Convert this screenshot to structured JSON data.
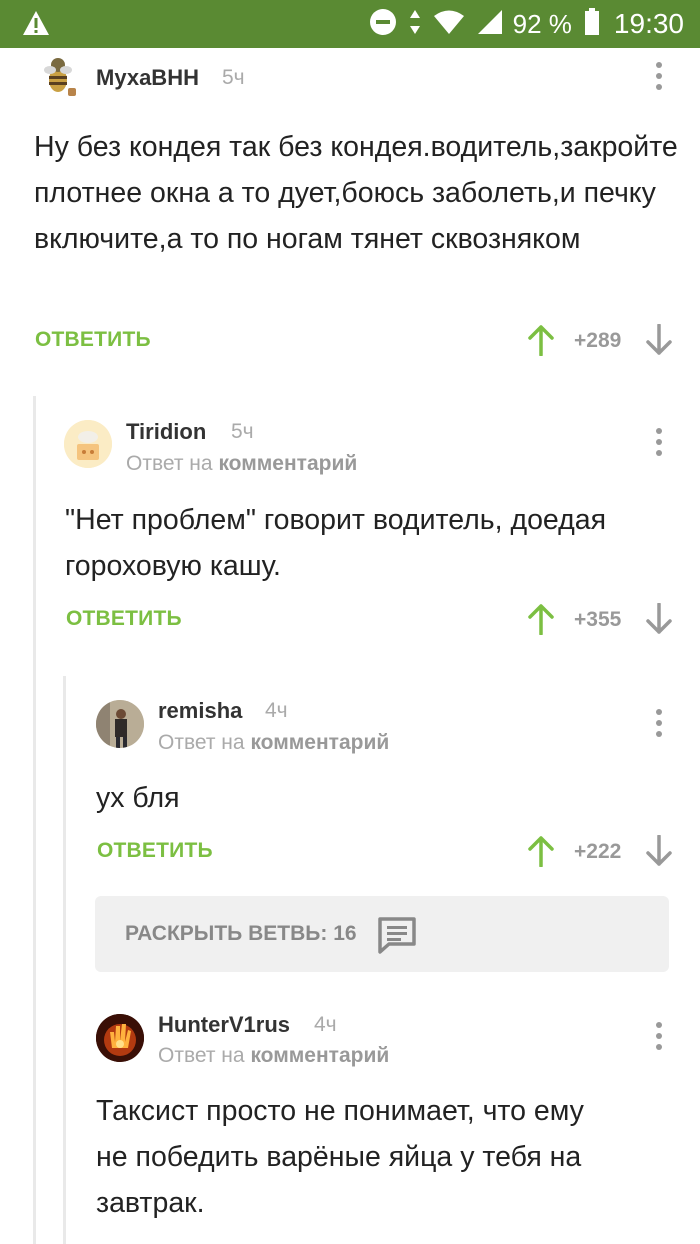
{
  "status_bar": {
    "battery": "92 %",
    "time": "19:30",
    "icons": [
      "warning-icon",
      "do-not-disturb-icon",
      "data-arrows-icon",
      "wifi-icon",
      "signal-icon",
      "battery-icon"
    ]
  },
  "colors": {
    "status_bar": "#5a8a33",
    "accent_green": "#7cbf42",
    "muted": "#999999"
  },
  "comments": [
    {
      "author": "МухаВНН",
      "time": "5ч",
      "reply_info": null,
      "text": "Ну без кондея так без кондея.водитель,закройте плотнее окна а то дует,боюсь заболеть,и печку включите,а то по ногам тянет сквозняком",
      "reply_label": "ОТВЕТИТЬ",
      "votes": "+289"
    },
    {
      "author": "Tiridion",
      "time": "5ч",
      "reply_prefix": "Ответ на",
      "reply_target": "комментарий",
      "text": "\"Нет проблем\" говорит водитель, доедая гороховую кашу.",
      "reply_label": "ОТВЕТИТЬ",
      "votes": "+355"
    },
    {
      "author": "remisha",
      "time": "4ч",
      "reply_prefix": "Ответ на",
      "reply_target": "комментарий",
      "text": "ух бля",
      "reply_label": "ОТВЕТИТЬ",
      "votes": "+222"
    },
    {
      "author": "HunterV1rus",
      "time": "4ч",
      "reply_prefix": "Ответ на",
      "reply_target": "комментарий",
      "text": "Таксист просто не понимает, что ему не победить варёные яйца у тебя на завтрак.",
      "reply_label": null,
      "votes": null
    }
  ],
  "expand_branch": {
    "label": "РАСКРЫТЬ ВЕТВЬ: 16",
    "icon": "comments-icon"
  }
}
